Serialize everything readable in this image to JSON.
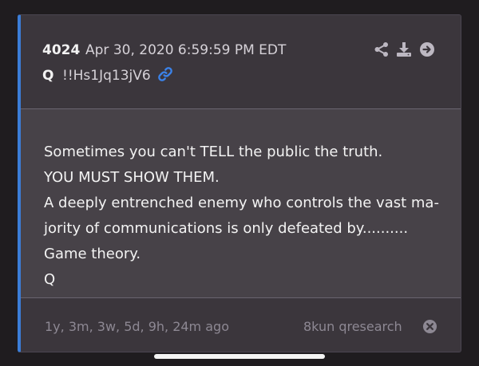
{
  "post": {
    "number": "4024",
    "timestamp": "Apr 30, 2020 6:59:59 PM EDT",
    "author": "Q",
    "tripcode": "!!Hs1Jq13jV6",
    "message_lines": [
      "Sometimes you can't TELL the public the truth.",
      "YOU MUST SHOW THEM.",
      "A deeply entrenched enemy who controls the vast ma-",
      "jority of communications is only defeated by..........",
      "Game theory.",
      "Q"
    ]
  },
  "footer": {
    "age": "1y, 3m, 3w, 5d, 9h, 24m ago",
    "source": "8kun qresearch"
  },
  "icons": {
    "link": "link-icon",
    "share": "share-icon",
    "download": "download-icon",
    "open": "arrow-right-circle-icon",
    "close": "close-circle-icon"
  },
  "colors": {
    "accent": "#3b7dd8",
    "card_bg": "#3a353b",
    "body_bg": "#474248",
    "page_bg": "#1f1c1f"
  }
}
